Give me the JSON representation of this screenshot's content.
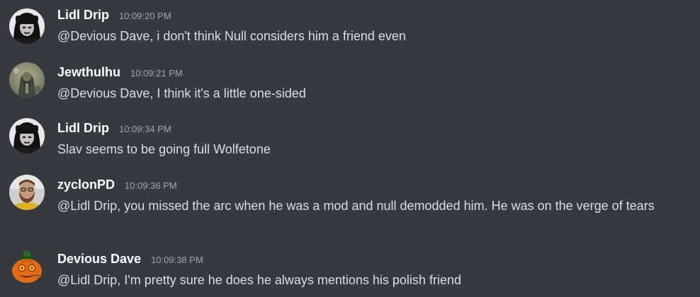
{
  "messages": [
    {
      "author": "Lidl Drip",
      "time": "10:09:20 PM",
      "text": "@Devious Dave, i don't think Null considers him a friend even",
      "avatar": "goth-woman-avatar"
    },
    {
      "author": "Jewthulhu",
      "time": "10:09:21 PM",
      "text": "@Devious Dave, I think it's a little one-sided",
      "avatar": "robed-figure-avatar"
    },
    {
      "author": "Lidl Drip",
      "time": "10:09:34 PM",
      "text": "Slav seems to be going full Wolfetone",
      "avatar": "goth-woman-avatar"
    },
    {
      "author": "zyclonPD",
      "time": "10:09:36 PM",
      "text": "@Lidl Drip, you missed the arc when he was a mod and null demodded him. He was on the verge of tears",
      "avatar": "bearded-man-avatar"
    },
    {
      "author": "Devious Dave",
      "time": "10:09:38 PM",
      "text": "@Lidl Drip, I'm pretty sure he does he always mentions his polish friend",
      "avatar": "pumpkin-avatar"
    }
  ],
  "colors": {
    "background": "#36393f",
    "author": "#ffffff",
    "timestamp": "#a3a6aa",
    "message_text": "#dcddde"
  }
}
